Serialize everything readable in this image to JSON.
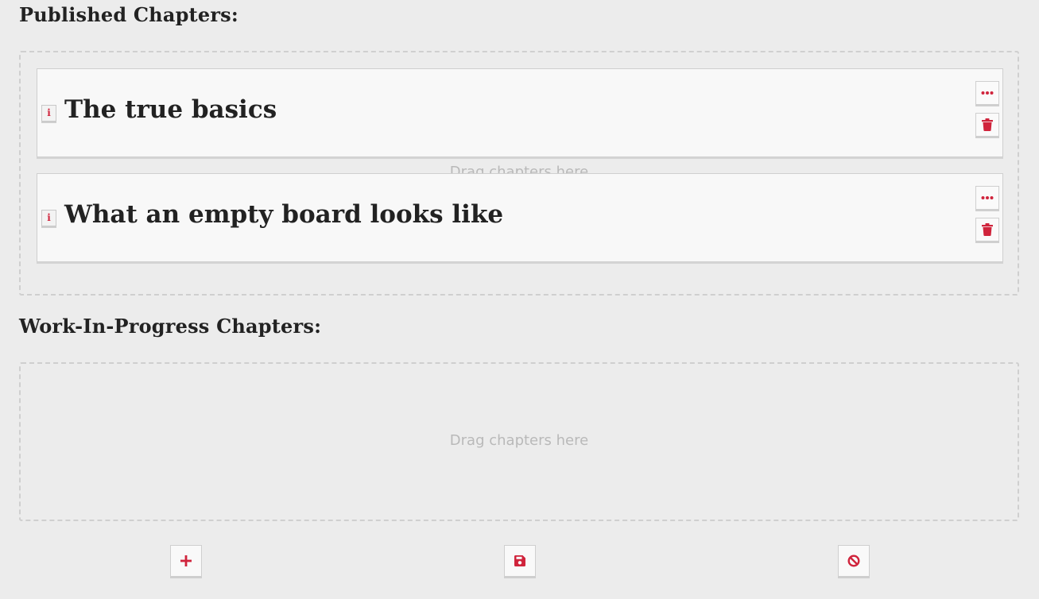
{
  "sections": {
    "published": {
      "heading": "Published Chapters:",
      "drop_hint": "Drag chapters here",
      "chapters": [
        {
          "title": "The true basics",
          "info_label": "i"
        },
        {
          "title": "What an empty board looks like",
          "info_label": "i"
        }
      ]
    },
    "wip": {
      "heading": "Work-In-Progress Chapters:",
      "drop_hint": "Drag chapters here"
    }
  },
  "icons": {
    "info": "info-icon",
    "more": "ellipsis-icon",
    "delete": "trash-icon",
    "add": "plus-icon",
    "save": "floppy-disk-icon",
    "cancel": "ban-icon"
  },
  "colors": {
    "background": "#ececec",
    "card": "#f8f8f8",
    "accent": "#d0243c",
    "dashed_border": "#cfcfcf",
    "hint_text": "#b9b9b9"
  }
}
